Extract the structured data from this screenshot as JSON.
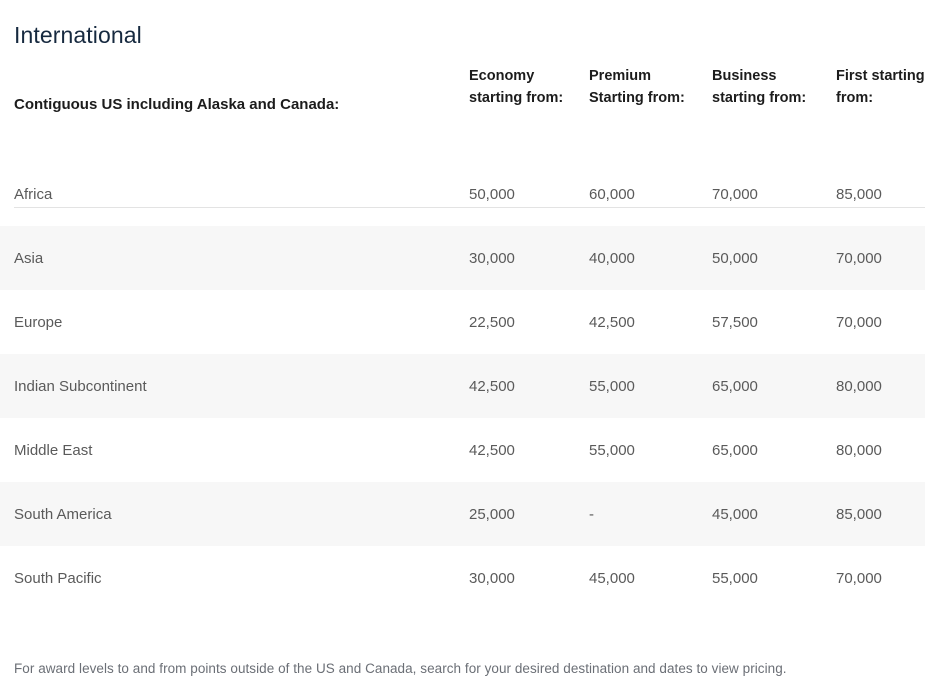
{
  "section": {
    "title": "International"
  },
  "table": {
    "row_header_label": "Contiguous US including Alaska and Canada:",
    "columns": [
      {
        "label": "Economy starting from:",
        "key": "economy"
      },
      {
        "label": "Premium Starting from:",
        "key": "premium"
      },
      {
        "label": "Business starting from:",
        "key": "business"
      },
      {
        "label": "First starting from:",
        "key": "first"
      }
    ],
    "rows": [
      {
        "region": "Africa",
        "economy": "50,000",
        "premium": "60,000",
        "business": "70,000",
        "first": "85,000",
        "striped": false
      },
      {
        "region": "Asia",
        "economy": "30,000",
        "premium": "40,000",
        "business": "50,000",
        "first": "70,000",
        "striped": true
      },
      {
        "region": "Europe",
        "economy": "22,500",
        "premium": "42,500",
        "business": "57,500",
        "first": "70,000",
        "striped": false
      },
      {
        "region": "Indian Subcontinent",
        "economy": "42,500",
        "premium": "55,000",
        "business": "65,000",
        "first": "80,000",
        "striped": true
      },
      {
        "region": "Middle East",
        "economy": "42,500",
        "premium": "55,000",
        "business": "65,000",
        "first": "80,000",
        "striped": false
      },
      {
        "region": "South America",
        "economy": "25,000",
        "premium": "-",
        "business": "45,000",
        "first": "85,000",
        "striped": true
      },
      {
        "region": "South Pacific",
        "economy": "30,000",
        "premium": "45,000",
        "business": "55,000",
        "first": "70,000",
        "striped": false
      }
    ]
  },
  "footnote": {
    "text": "For award levels to and from points outside of the US and Canada, search for your desired destination and dates to view pricing."
  },
  "colors": {
    "title": "#16293f",
    "header_text": "#1c1c1c",
    "body_text": "#5a5a5a",
    "stripe": "#f7f7f7",
    "divider": "#e3e3e3",
    "footnote": "#6b6f76",
    "background": "#ffffff"
  }
}
